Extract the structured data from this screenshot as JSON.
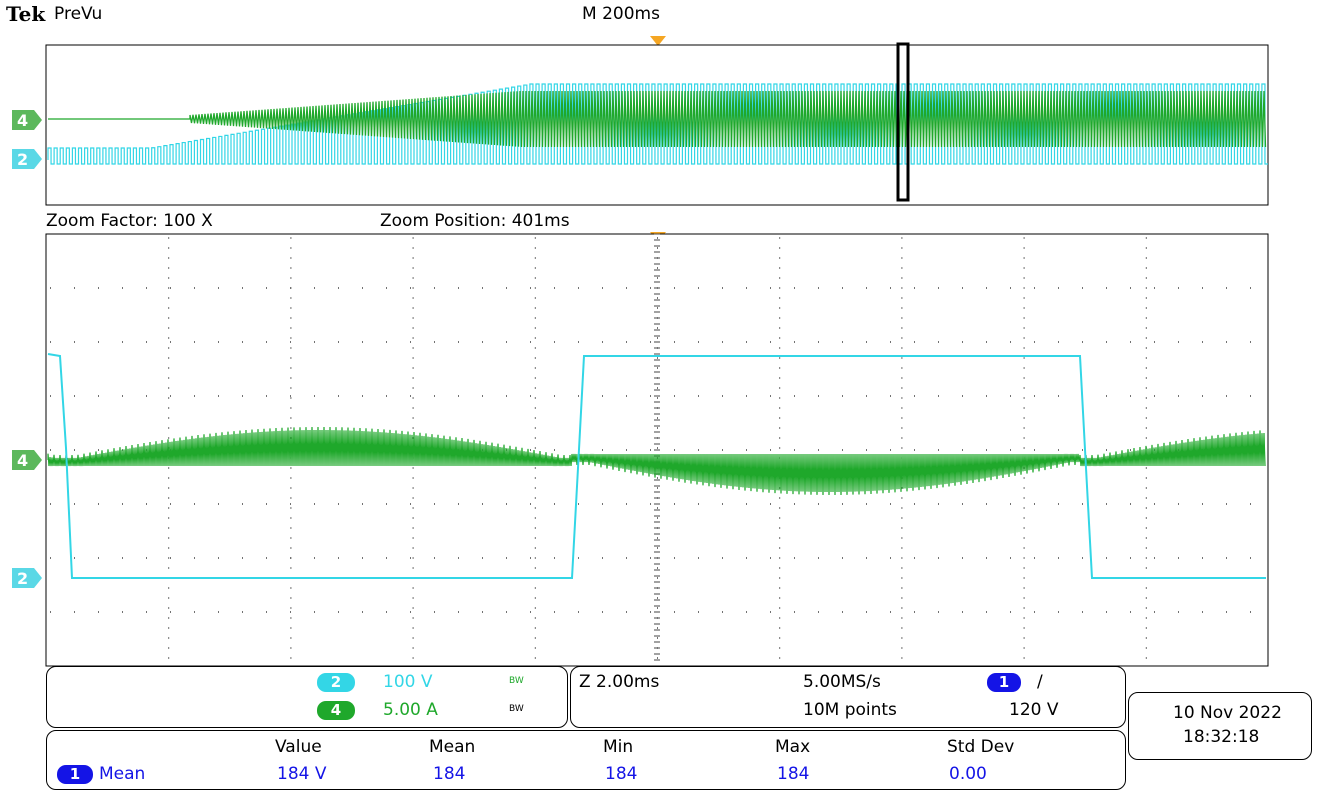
{
  "header": {
    "brand": "Tek",
    "mode": "PreVu",
    "timebase": "M 200ms"
  },
  "zoom": {
    "factor_label": "Zoom Factor: 100 X",
    "position_label": "Zoom Position: 401ms"
  },
  "channels": [
    {
      "id": "2",
      "scale": "100 V",
      "bw": "BW",
      "color": "#33d6e6"
    },
    {
      "id": "4",
      "scale": "5.00 A",
      "bw": "BW",
      "color": "#1fa82b"
    }
  ],
  "acquisition": {
    "zoom_scale": "Z 2.00ms",
    "sample_rate": "5.00MS/s",
    "record_length": "10M points",
    "trigger_channel": "1",
    "trigger_slope": "/",
    "trigger_level": "120 V"
  },
  "datetime": {
    "date": "10 Nov  2022",
    "time": "18:32:18"
  },
  "measurements": {
    "headers": [
      "Value",
      "Mean",
      "Min",
      "Max",
      "Std Dev"
    ],
    "rows": [
      {
        "source": "1",
        "name": "Mean",
        "value": "184 V",
        "mean": "184",
        "min": "184",
        "max": "184",
        "std_dev": "0.00"
      }
    ]
  },
  "colors": {
    "ch2": "#33d6e6",
    "ch4": "#1fa82b",
    "ch1": "#1414e6",
    "trigger_marker": "#f5a623"
  }
}
